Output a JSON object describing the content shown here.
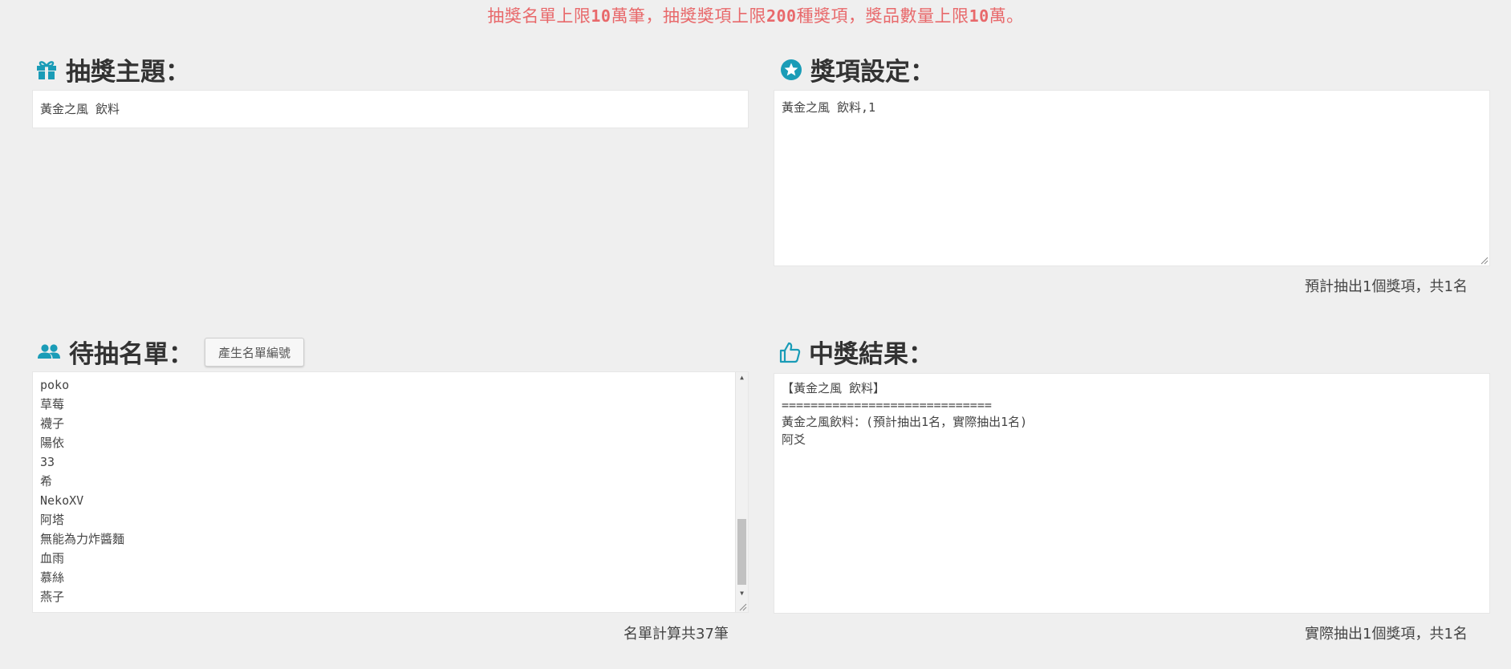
{
  "notice": {
    "part1": "抽獎名單上限",
    "num1": "10",
    "part2": "萬筆，抽獎獎項上限",
    "num2": "200",
    "part3": "種獎項，獎品數量上限",
    "num3": "10",
    "part4": "萬。"
  },
  "theme": {
    "title": "抽獎主題：",
    "icon": "gift-icon",
    "value": "黃金之風 飲料"
  },
  "prizes": {
    "title": "獎項設定：",
    "icon": "star-icon",
    "value": "黃金之風 飲料,1",
    "summary": "預計抽出1個獎項，共1名"
  },
  "candidates": {
    "title": "待抽名單：",
    "icon": "users-icon",
    "generate_button": "產生名單編號",
    "items": [
      "poko",
      "草莓",
      "襪子",
      "陽依",
      "33",
      "希",
      "NekoXV",
      "阿塔",
      "無能為力炸醬麵",
      "血雨",
      "慕絲",
      "燕子"
    ],
    "count": "名單計算共37筆"
  },
  "results": {
    "title": "中獎結果：",
    "icon": "thumbs-up-icon",
    "lines": [
      "【黃金之風 飲料】",
      "=============================",
      "黃金之風飲料：(預計抽出1名，實際抽出1名)",
      "阿爻"
    ],
    "summary": "實際抽出1個獎項，共1名"
  },
  "colors": {
    "notice": "#e8696b",
    "icon": "#1a9cb7",
    "background": "#efefef"
  }
}
